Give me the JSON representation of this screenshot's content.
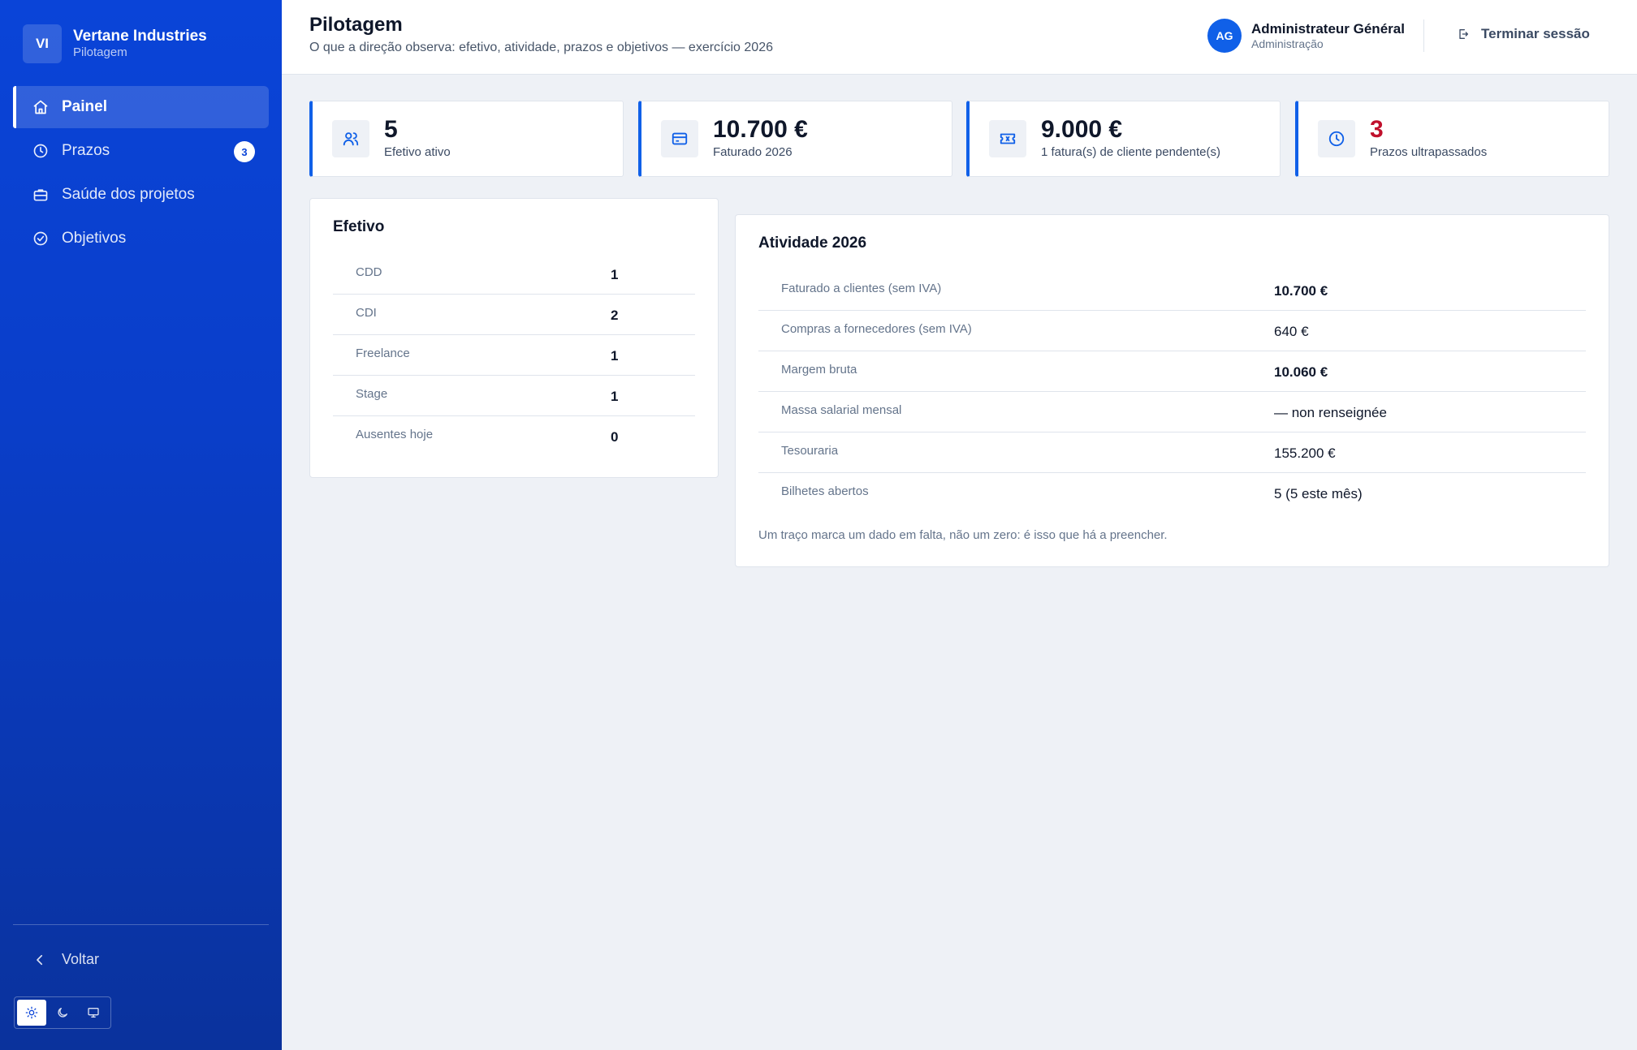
{
  "brand": {
    "logo": "VI",
    "name": "Vertane Industries",
    "subtitle": "Pilotagem"
  },
  "sidebar": {
    "items": [
      {
        "label": "Painel",
        "icon": "home-icon",
        "active": true
      },
      {
        "label": "Prazos",
        "icon": "clock-icon",
        "badge": "3"
      },
      {
        "label": "Saúde dos projetos",
        "icon": "briefcase-icon"
      },
      {
        "label": "Objetivos",
        "icon": "check-circle-icon"
      }
    ],
    "back_label": "Voltar",
    "theme": [
      "sun-icon",
      "moon-icon",
      "monitor-icon"
    ]
  },
  "header": {
    "title": "Pilotagem",
    "subtitle": "O que a direção observa: efetivo, atividade, prazos e objetivos — exercício 2026",
    "user": {
      "initials": "AG",
      "name": "Administrateur Général",
      "role": "Administração"
    },
    "logout_label": "Terminar sessão"
  },
  "kpis": [
    {
      "value": "5",
      "label": "Efetivo ativo",
      "icon": "users-icon"
    },
    {
      "value": "10.700 €",
      "label": "Faturado 2026",
      "icon": "credit-card-icon"
    },
    {
      "value": "9.000 €",
      "label": "1 fatura(s) de cliente pendente(s)",
      "icon": "ticket-icon"
    },
    {
      "value": "3",
      "label": "Prazos ultrapassados",
      "icon": "clock-icon",
      "status_color": "#c0102c"
    }
  ],
  "efetivo": {
    "title": "Efetivo",
    "rows": [
      {
        "label": "CDD",
        "value": "1"
      },
      {
        "label": "CDI",
        "value": "2"
      },
      {
        "label": "Freelance",
        "value": "1"
      },
      {
        "label": "Stage",
        "value": "1"
      },
      {
        "label": "Ausentes hoje",
        "value": "0"
      }
    ]
  },
  "atividade": {
    "title": "Atividade 2026",
    "rows": [
      {
        "label": "Faturado a clientes (sem IVA)",
        "value": "10.700 €"
      },
      {
        "label": "Compras a fornecedores (sem IVA)",
        "value": "640 €"
      },
      {
        "label": "Margem bruta",
        "value": "10.060 €"
      },
      {
        "label": "Massa salarial mensal",
        "value": "— non renseignée"
      },
      {
        "label": "Tesouraria",
        "value": "155.200 €"
      },
      {
        "label": "Bilhetes abertos",
        "value": "5 (5 este mês)"
      }
    ],
    "note": "Um traço marca um dado em falta, não um zero: é isso que há a preencher."
  },
  "colors": {
    "accent": "#1060e8",
    "sidebar": "#0a44d8",
    "danger": "#c0102c"
  }
}
